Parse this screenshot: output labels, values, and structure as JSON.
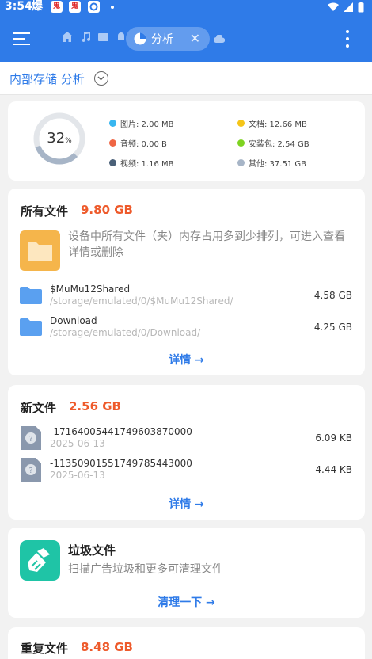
{
  "status_bar": {
    "time": "3:54",
    "app_text": "爆",
    "badge1": "鬼",
    "badge2": "鬼"
  },
  "app_bar": {
    "active_tab": "分析",
    "colors": {
      "primary": "#2f7be8",
      "accent_orange": "#ee5a2b"
    },
    "icons": [
      "menu-icon",
      "home-icon",
      "music-icon",
      "video-icon",
      "android-icon",
      "pie-icon",
      "close-icon",
      "cloud-icon",
      "more-vert-icon"
    ]
  },
  "subtitle": "内部存储 分析",
  "summary": {
    "percent": "32",
    "percent_sign": "%",
    "used_fraction": 0.32,
    "legend": [
      {
        "label": "图片: 2.00 MB",
        "color": "#38b6f0"
      },
      {
        "label": "文档: 12.66 MB",
        "color": "#f5c518"
      },
      {
        "label": "音频: 0.00 B",
        "color": "#ef6644"
      },
      {
        "label": "安装包: 2.54 GB",
        "color": "#7ed321"
      },
      {
        "label": "视频: 1.16 MB",
        "color": "#4a6078"
      },
      {
        "label": "其他: 37.51 GB",
        "color": "#a7b5c7"
      }
    ]
  },
  "all_files": {
    "title": "所有文件",
    "size": "9.80 GB",
    "description": "设备中所有文件（夹）内存占用多到少排列，可进入查看详情或删除",
    "rows": [
      {
        "name": "$MuMu12Shared",
        "path": "/storage/emulated/0/$MuMu12Shared/",
        "size": "4.58 GB"
      },
      {
        "name": "Download",
        "path": "/storage/emulated/0/Download/",
        "size": "4.25 GB"
      }
    ],
    "link": "详情 →"
  },
  "new_files": {
    "title": "新文件",
    "size": "2.56 GB",
    "rows": [
      {
        "name": "-1716400544174960387000​0",
        "date": "2025-06-13",
        "size": "6.09 KB"
      },
      {
        "name": "-1135090155174978544300​0",
        "date": "2025-06-13",
        "size": "4.44 KB"
      }
    ],
    "link": "详情 →"
  },
  "junk": {
    "title": "垃圾文件",
    "description": "扫描广告垃圾和更多可清理文件",
    "link": "清理一下 →"
  },
  "duplicates": {
    "title": "重复文件",
    "size": "8.48 GB"
  }
}
